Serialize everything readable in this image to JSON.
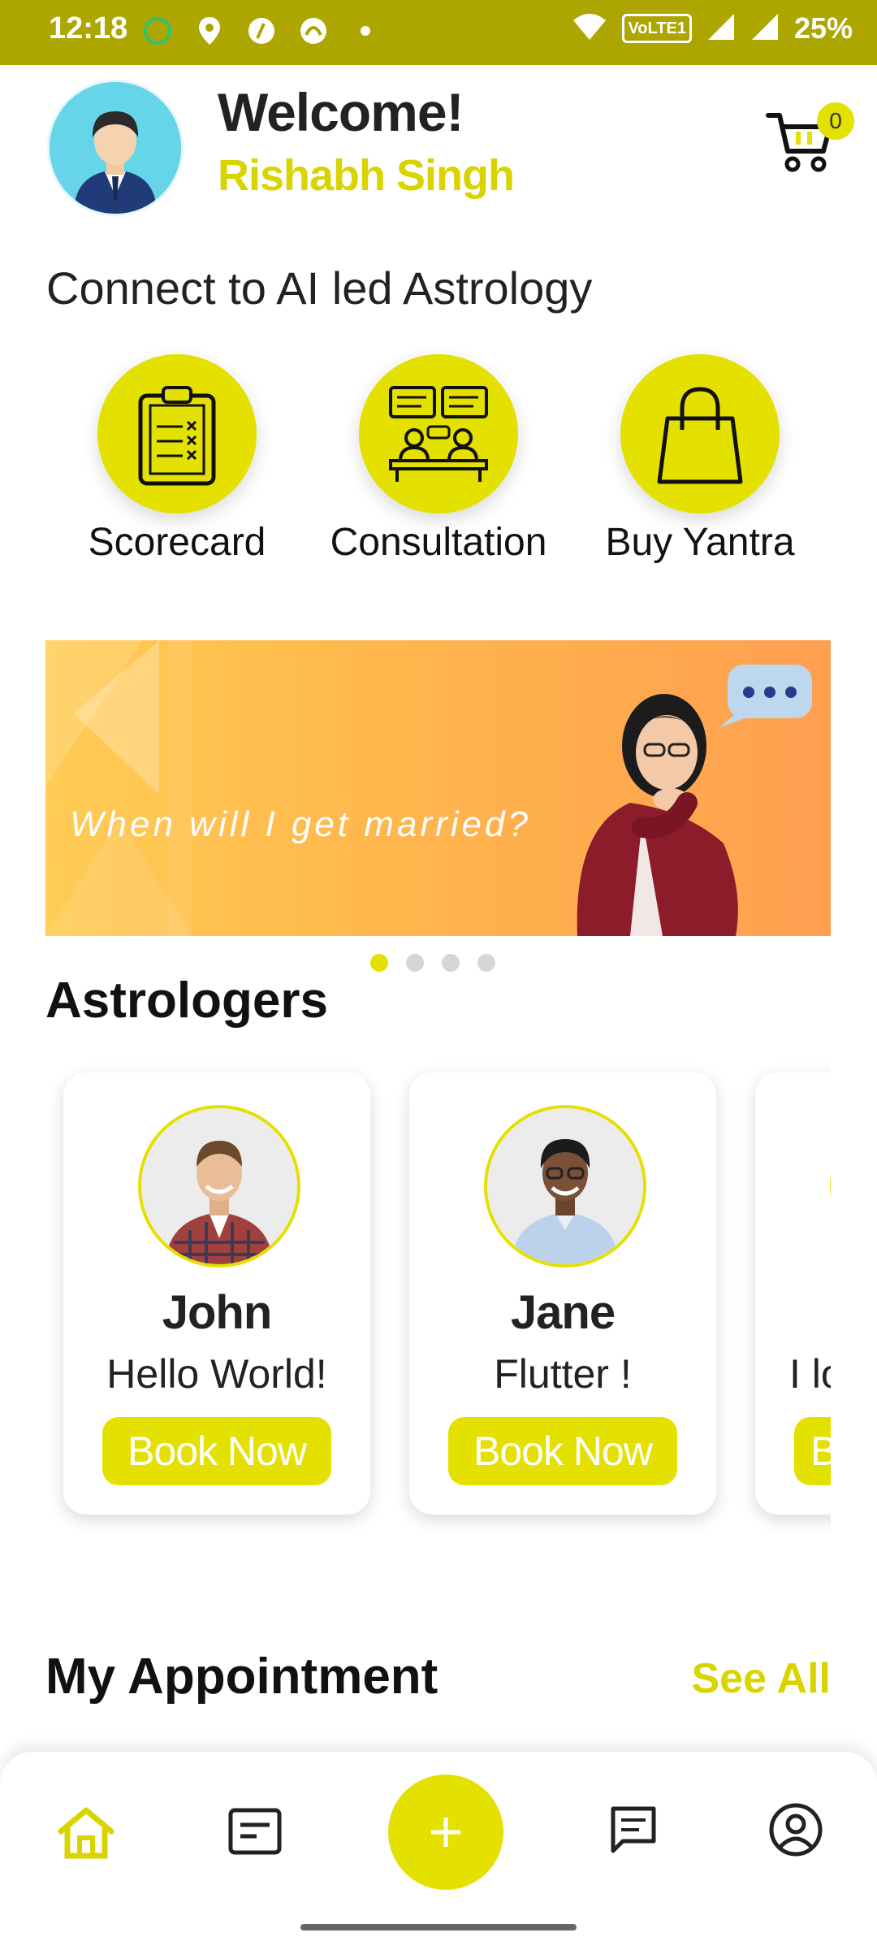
{
  "status_bar": {
    "time": "12:18",
    "battery": "25%",
    "icons": [
      "whatsapp-icon",
      "location-icon",
      "app-icon",
      "app-icon",
      "dot-icon",
      "wifi-icon",
      "volte-icon",
      "signal-icon",
      "signal-icon"
    ],
    "volte_label": "VoLTE1"
  },
  "header": {
    "welcome": "Welcome!",
    "user_name": "Rishabh Singh",
    "cart_count": "0"
  },
  "connect_section": {
    "title": "Connect to AI led Astrology",
    "actions": [
      {
        "label": "Scorecard",
        "icon": "clipboard-icon"
      },
      {
        "label": "Consultation",
        "icon": "consultation-icon"
      },
      {
        "label": "Buy Yantra",
        "icon": "shopping-bag-icon"
      }
    ]
  },
  "banner": {
    "text": "When will I get married?",
    "slides_total": 4,
    "active_slide": 1
  },
  "astrologers": {
    "title": "Astrologers",
    "cards": [
      {
        "name": "John",
        "description": "Hello World!",
        "button": "Book Now"
      },
      {
        "name": "Jane",
        "description": "Flutter !",
        "button": "Book Now"
      },
      {
        "name": "",
        "description": "I lo",
        "button": "B"
      }
    ]
  },
  "appointments": {
    "title": "My Appointment",
    "see_all": "See All"
  },
  "bottom_nav": {
    "items": [
      "home-icon",
      "notes-icon",
      "add-icon",
      "chat-icon",
      "profile-icon"
    ]
  },
  "colors": {
    "accent": "#E4E000",
    "accent_text": "#D9D400",
    "status_bar": "#ADA600"
  }
}
